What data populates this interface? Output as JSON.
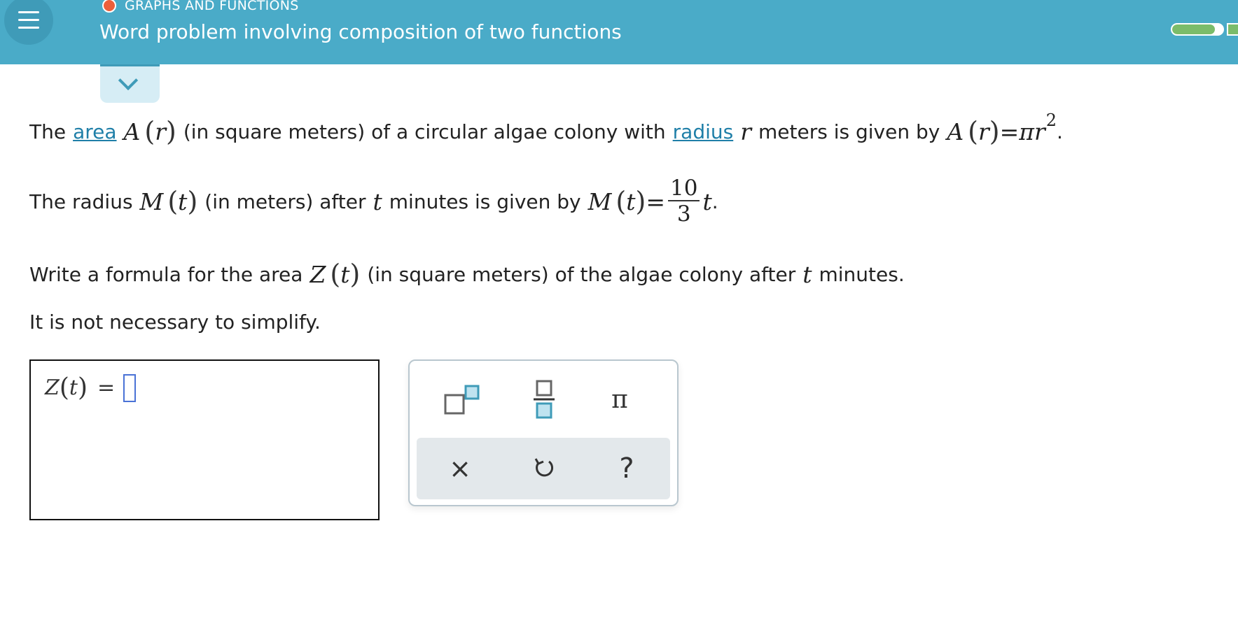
{
  "header": {
    "category": "GRAPHS AND FUNCTIONS",
    "title": "Word problem involving composition of two functions",
    "progress_fraction": 0.85,
    "colors": {
      "bar": "#4aabc8",
      "category_dot": "#ec5f3b",
      "progress": "#7bbc6a"
    }
  },
  "problem": {
    "line1": {
      "pre": "The",
      "link1": "area",
      "fn_name": "A",
      "fn_var": "r",
      "mid1": "(in square meters) of a circular algae colony with",
      "link2": "radius",
      "var": "r",
      "mid2": "meters is given by",
      "eq_fn": "A",
      "eq_var": "r",
      "eq_sign": "=",
      "rhs_pi": "π",
      "rhs_var": "r",
      "rhs_exp": "2",
      "end": "."
    },
    "line2": {
      "pre": "The radius",
      "fn_name": "M",
      "fn_var": "t",
      "mid1": "(in meters) after",
      "var": "t",
      "mid2": "minutes is given by",
      "eq_fn": "M",
      "eq_var": "t",
      "eq_sign": "=",
      "frac_num": "10",
      "frac_den": "3",
      "rhs_var": "t",
      "end": "."
    },
    "line3": {
      "pre": "Write a formula for the area",
      "fn_name": "Z",
      "fn_var": "t",
      "mid1": "(in square meters) of the algae colony after",
      "var": "t",
      "end": "minutes."
    },
    "line4": "It is not necessary to simplify."
  },
  "answer": {
    "fn_name": "Z",
    "fn_var": "t",
    "eq_sign": "="
  },
  "keypad": {
    "pi_label": "π",
    "clear_label": "×",
    "help_label": "?",
    "icons": [
      "superscript-icon",
      "fraction-icon",
      "pi-icon",
      "clear-icon",
      "undo-icon",
      "help-icon"
    ]
  }
}
